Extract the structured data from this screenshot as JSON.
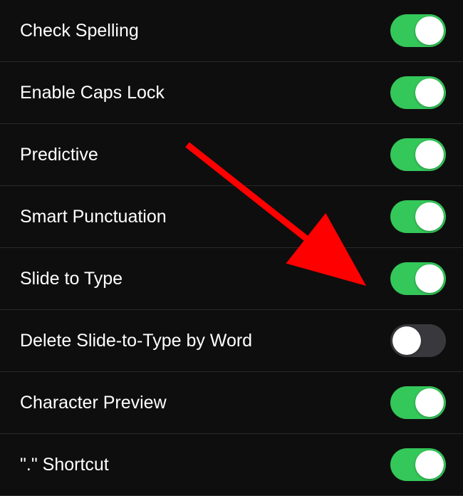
{
  "settings": [
    {
      "id": "check-spelling",
      "label": "Check Spelling",
      "enabled": true
    },
    {
      "id": "enable-caps-lock",
      "label": "Enable Caps Lock",
      "enabled": true
    },
    {
      "id": "predictive",
      "label": "Predictive",
      "enabled": true
    },
    {
      "id": "smart-punctuation",
      "label": "Smart Punctuation",
      "enabled": true
    },
    {
      "id": "slide-to-type",
      "label": "Slide to Type",
      "enabled": true
    },
    {
      "id": "delete-slide-to-type-by-word",
      "label": "Delete Slide-to-Type by Word",
      "enabled": false
    },
    {
      "id": "character-preview",
      "label": "Character Preview",
      "enabled": true
    },
    {
      "id": "period-shortcut",
      "label": "\".\" Shortcut",
      "enabled": true
    }
  ],
  "colors": {
    "toggleOn": "#34c759",
    "toggleOff": "#39393d",
    "background": "#0e0e0e",
    "text": "#ffffff",
    "arrow": "#ff0000"
  }
}
